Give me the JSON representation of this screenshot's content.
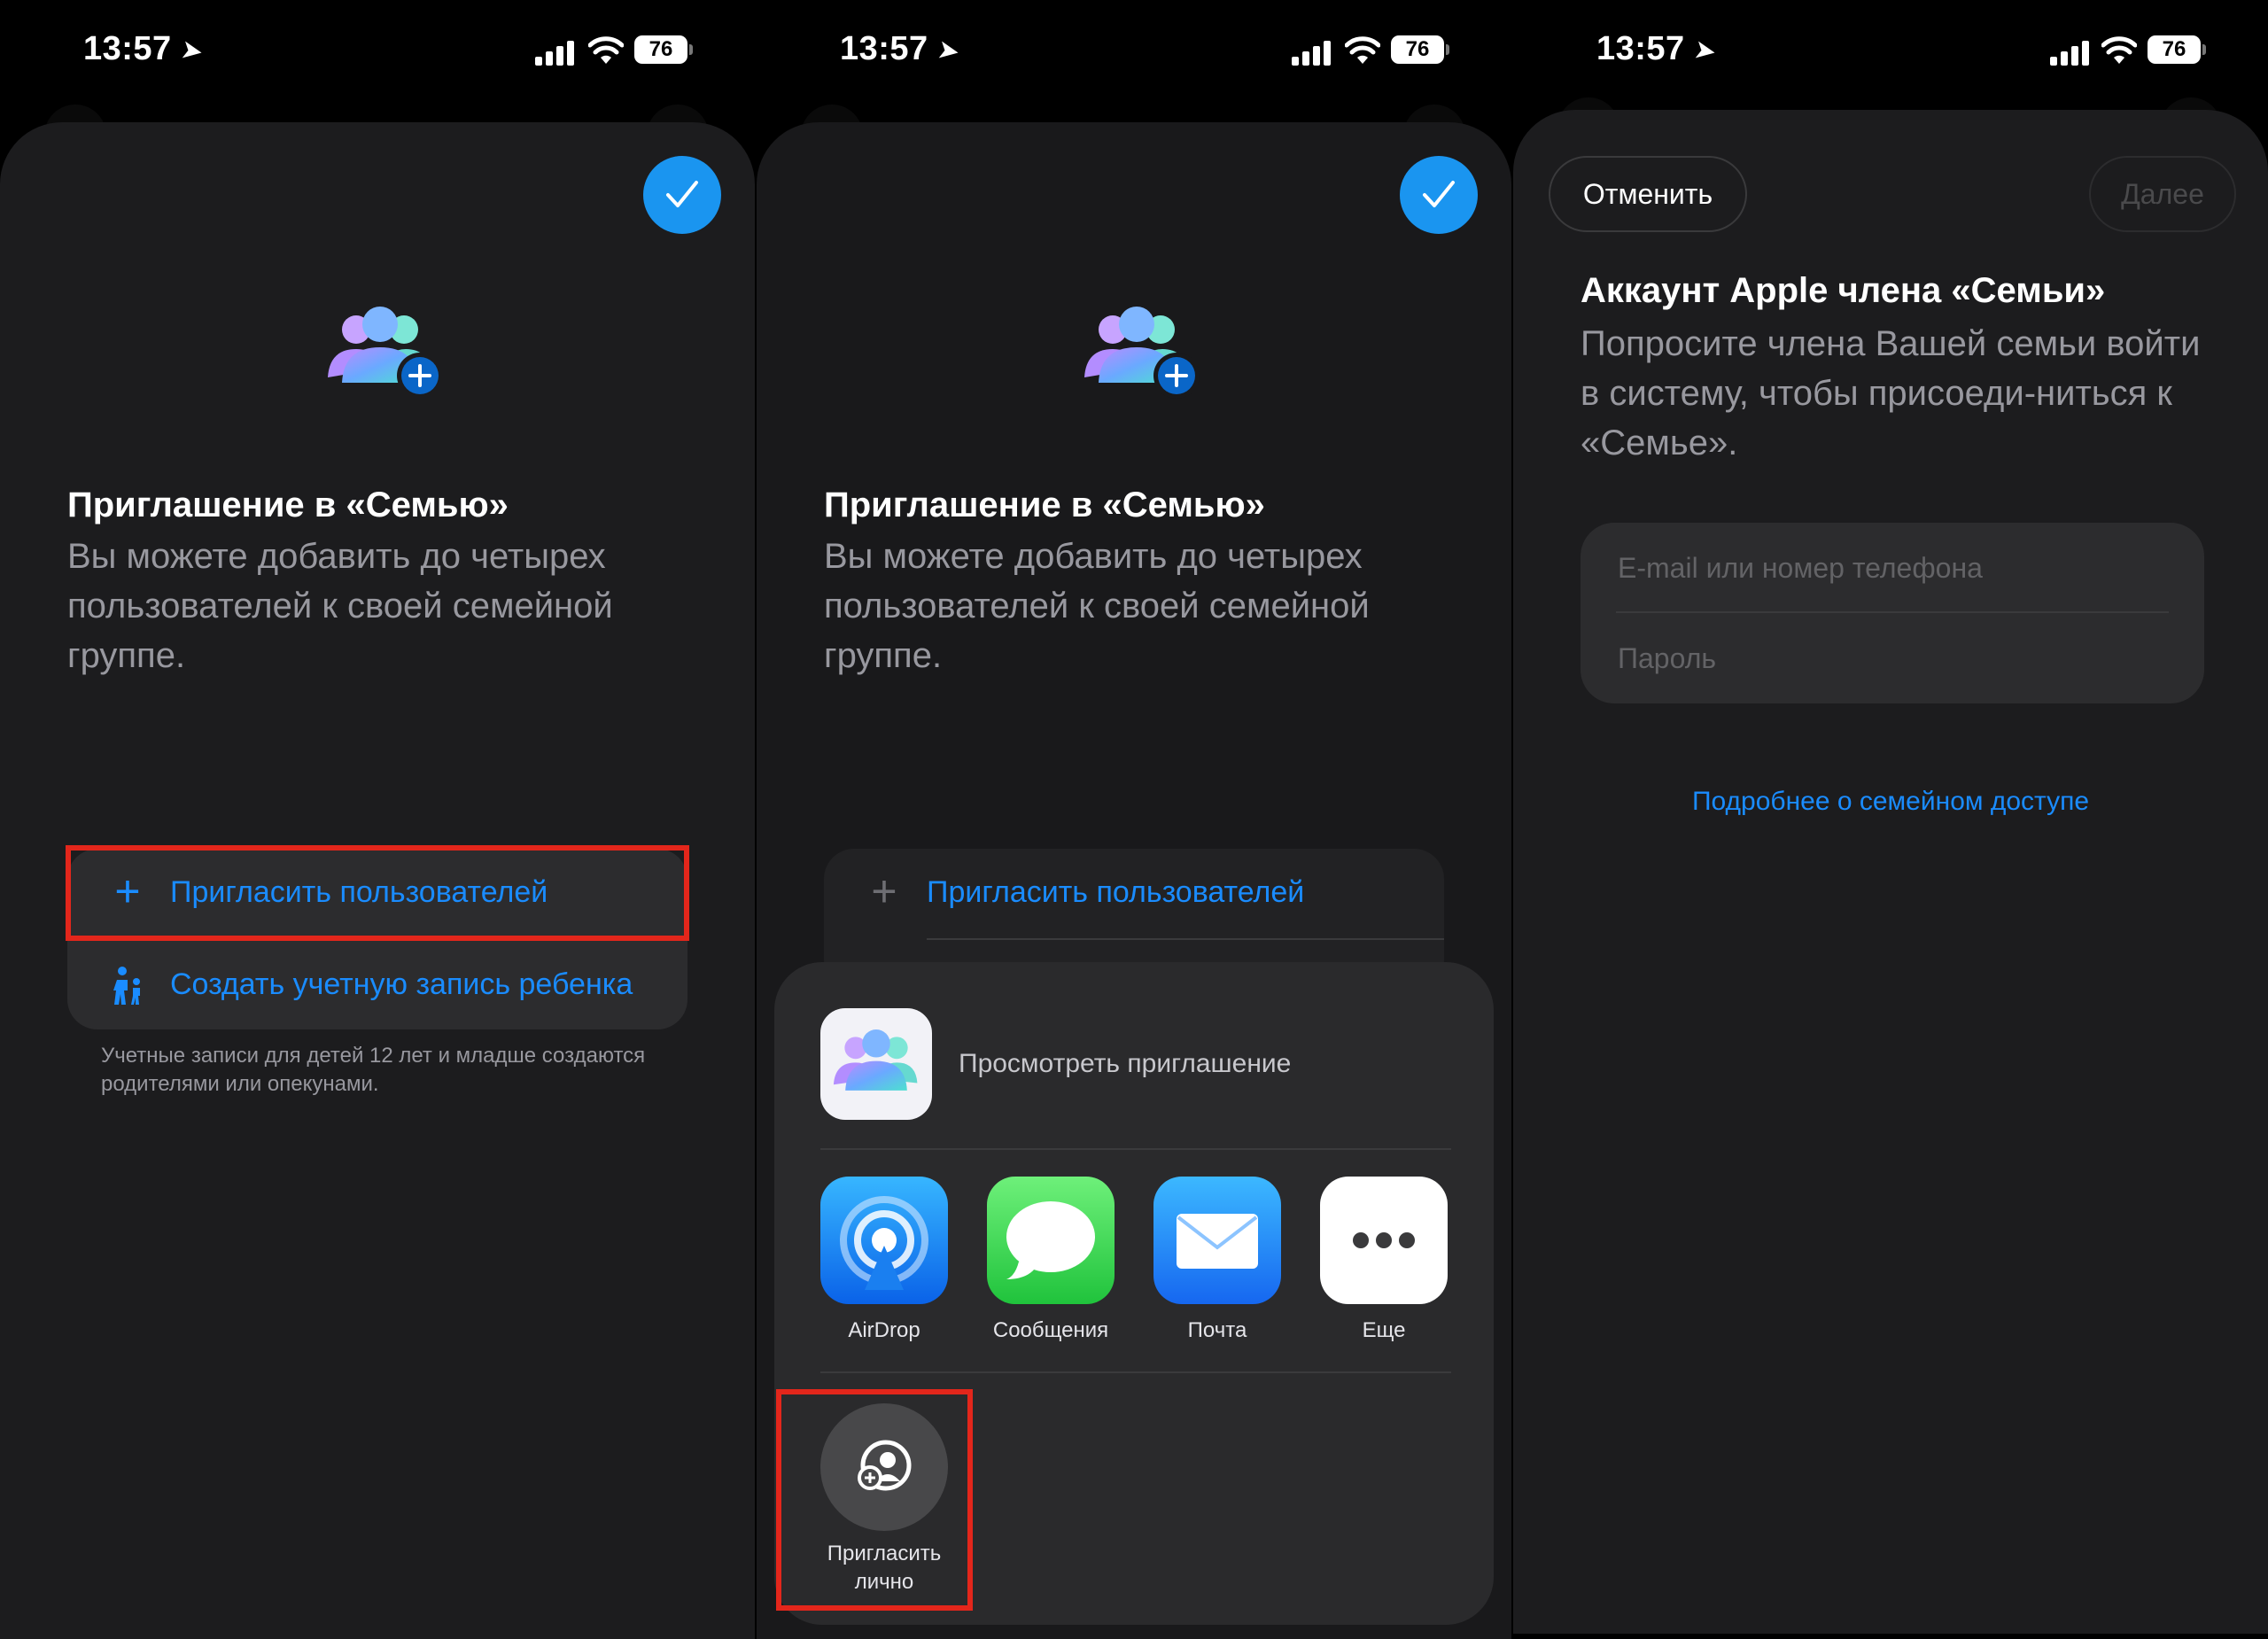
{
  "status_bar": {
    "time": "13:57",
    "battery": "76"
  },
  "screen1": {
    "title": "Приглашение в «Семью»",
    "description": "Вы можете добавить до четырех пользователей к своей семейной группе.",
    "options": [
      {
        "icon": "plus-icon",
        "label": "Пригласить пользователей"
      },
      {
        "icon": "child-icon",
        "label": "Создать учетную запись ребенка"
      }
    ],
    "note": "Учетные записи для детей 12 лет и младше создаются родителями или опекунами."
  },
  "screen2": {
    "title": "Приглашение в «Семью»",
    "description": "Вы можете добавить до четырех пользователей к своей семейной группе.",
    "invite_option": "Пригласить пользователей",
    "share_sheet": {
      "preview_label": "Просмотреть приглашение",
      "apps": [
        {
          "icon": "airdrop-icon",
          "label": "AirDrop"
        },
        {
          "icon": "messages-icon",
          "label": "Сообщения"
        },
        {
          "icon": "mail-icon",
          "label": "Почта"
        },
        {
          "icon": "more-icon",
          "label": "Еще"
        }
      ],
      "in_person": "Пригласить лично"
    }
  },
  "screen3": {
    "cancel": "Отменить",
    "next": "Далее",
    "title": "Аккаунт Apple члена «Семьи»",
    "description": "Попросите члена Вашей семьи войти в систему, чтобы присоеди-ниться к «Семье».",
    "email_placeholder": "E-mail или номер телефона",
    "password_placeholder": "Пароль",
    "link": "Подробнее о семейном доступе"
  },
  "colors": {
    "accent": "#1a8cff",
    "highlight": "#e3261b",
    "sheet": "#1c1c1e"
  }
}
